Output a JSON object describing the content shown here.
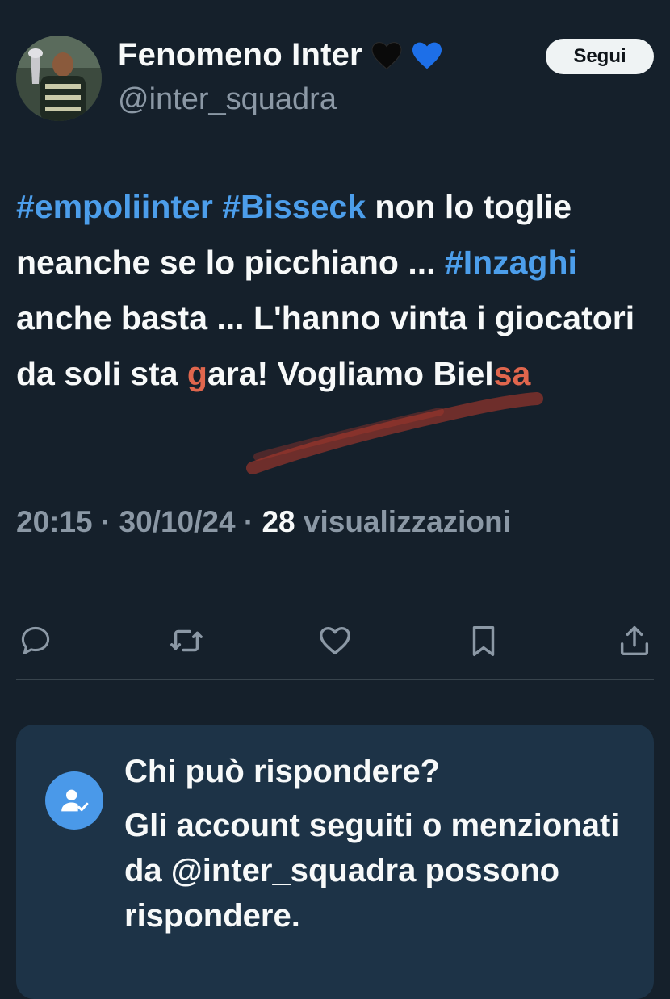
{
  "user": {
    "display_name": "Fenomeno Inter",
    "name_emojis": [
      "black-heart",
      "blue-heart"
    ],
    "handle": "@inter_squadra",
    "follow_label": "Segui"
  },
  "tweet": {
    "hashtag_1": "#empoliinter",
    "space_1": " ",
    "hashtag_2": "#Bisseck",
    "text_1": " non lo toglie neanche se lo picchiano ... ",
    "hashtag_3": "#Inzaghi",
    "text_2": " anche basta ... L'hanno vinta i giocatori da soli sta ",
    "text_red_1": "g",
    "text_3": "ara! Vogliamo Biel",
    "text_red_2": "sa",
    "time": "20:15",
    "separator": " · ",
    "date": "30/10/24",
    "views_count": "28",
    "views_label": " visualizzazioni"
  },
  "actions": {
    "icons": [
      "reply-icon",
      "retweet-icon",
      "like-icon",
      "bookmark-icon",
      "share-icon"
    ]
  },
  "reply_restriction": {
    "title": "Chi può rispondere?",
    "body": "Gli account seguiti o menzionati da @inter_squadra possono rispondere."
  },
  "colors": {
    "background": "#15202b",
    "hashtag": "#4c9eeb",
    "muted": "#8b98a5",
    "card": "#1d3347",
    "accent_red": "#e0664d"
  }
}
